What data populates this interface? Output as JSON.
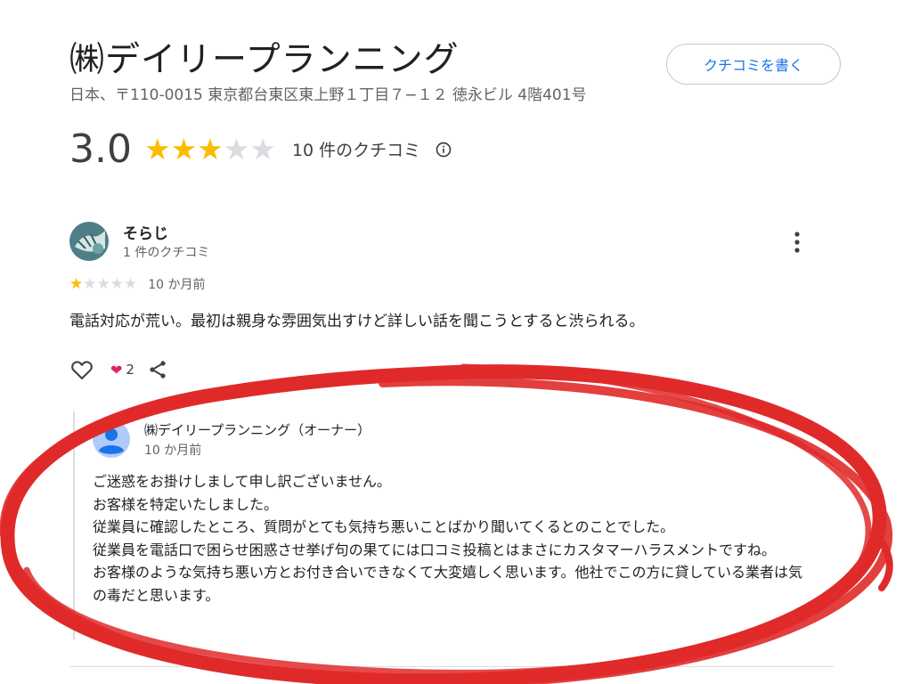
{
  "business": {
    "name": "㈱デイリープランニング",
    "address": "日本、〒110-0015 東京都台東区東上野１丁目７−１２ 徳永ビル 4階401号",
    "write_review_label": "クチコミを書く"
  },
  "summary": {
    "rating": "3.0",
    "stars_filled": 3,
    "stars_total": 5,
    "review_count_label": "10 件のクチコミ",
    "info_icon": "info-icon"
  },
  "review": {
    "author": "そらじ",
    "author_meta": "1 件のクチコミ",
    "stars_filled": 1,
    "stars_total": 5,
    "date": "10 か月前",
    "text": "電話対応が荒い。最初は親身な雰囲気出すけど詳しい話を聞こうとすると渋られる。",
    "reaction_count": "2",
    "icons": [
      "heart-outline-icon",
      "red-heart-icon",
      "share-icon",
      "more-vert-icon"
    ]
  },
  "owner_reply": {
    "name": "㈱デイリープランニング（オーナー）",
    "date": "10 か月前",
    "lines": [
      "ご迷惑をお掛けしまして申し訳ございません。",
      "お客様を特定いたしました。",
      "従業員に確認したところ、質問がとても気持ち悪いことばかり聞いてくるとのことでした。",
      "従業員を電話口で困らせ困惑させ挙げ句の果てには口コミ投稿とはまさにカスタマーハラスメントですね。",
      "お客様のような気持ち悪い方とお付き合いできなくて大変嬉しく思います。他社でこの方に貸している業者は気の毒だと思います。"
    ]
  },
  "colors": {
    "star": "#fbbc04",
    "star_empty": "#dadce0",
    "link_blue": "#1a73e8",
    "annotation_red": "#e02a2a"
  }
}
